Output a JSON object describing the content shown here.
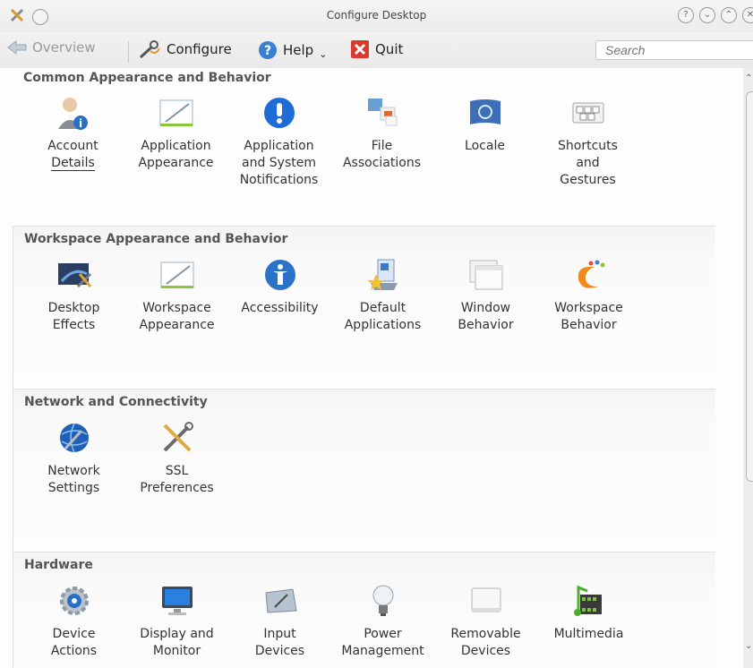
{
  "window": {
    "title": "Configure Desktop"
  },
  "toolbar": {
    "overview_label": "Overview",
    "configure_label": "Configure",
    "help_label": "Help",
    "quit_label": "Quit",
    "search_placeholder": "Search"
  },
  "sections": [
    {
      "title": "Common Appearance and Behavior",
      "items": [
        {
          "label": "Account\nDetails",
          "icon": "account-icon"
        },
        {
          "label": "Application\nAppearance",
          "icon": "appearance-icon"
        },
        {
          "label": "Application\nand System\nNotifications",
          "icon": "notification-icon"
        },
        {
          "label": "File\nAssociations",
          "icon": "file-associations-icon"
        },
        {
          "label": "Locale",
          "icon": "locale-icon"
        },
        {
          "label": "Shortcuts\nand\nGestures",
          "icon": "keyboard-icon"
        }
      ]
    },
    {
      "title": "Workspace Appearance and Behavior",
      "items": [
        {
          "label": "Desktop\nEffects",
          "icon": "desktop-effects-icon"
        },
        {
          "label": "Workspace\nAppearance",
          "icon": "appearance-icon"
        },
        {
          "label": "Accessibility",
          "icon": "accessibility-icon"
        },
        {
          "label": "Default\nApplications",
          "icon": "default-apps-icon"
        },
        {
          "label": "Window\nBehavior",
          "icon": "window-icon"
        },
        {
          "label": "Workspace\nBehavior",
          "icon": "workspace-behavior-icon"
        }
      ]
    },
    {
      "title": "Network and Connectivity",
      "items": [
        {
          "label": "Network\nSettings",
          "icon": "network-icon"
        },
        {
          "label": "SSL\nPreferences",
          "icon": "tools-icon"
        }
      ]
    },
    {
      "title": "Hardware",
      "items": [
        {
          "label": "Device\nActions",
          "icon": "gear-icon"
        },
        {
          "label": "Display and\nMonitor",
          "icon": "monitor-icon"
        },
        {
          "label": "Input\nDevices",
          "icon": "input-devices-icon"
        },
        {
          "label": "Power\nManagement",
          "icon": "bulb-icon"
        },
        {
          "label": "Removable\nDevices",
          "icon": "drive-icon"
        },
        {
          "label": "Multimedia",
          "icon": "multimedia-icon"
        }
      ]
    }
  ]
}
